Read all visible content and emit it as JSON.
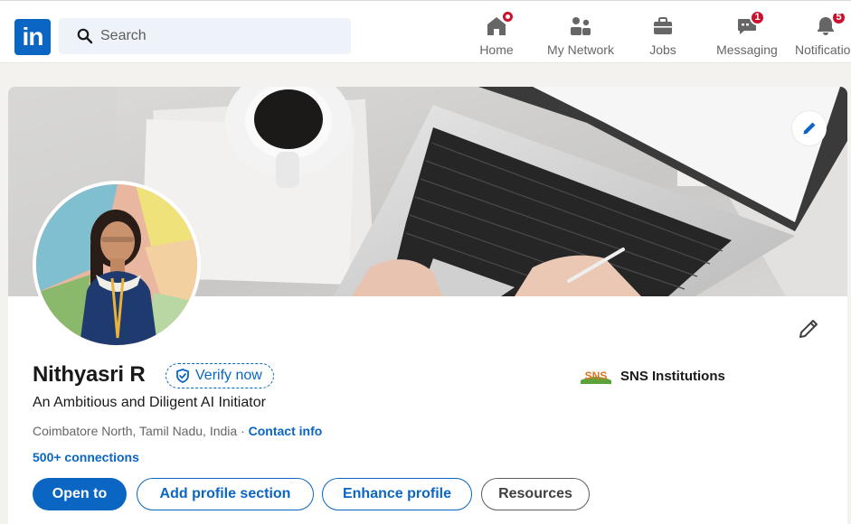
{
  "nav": {
    "search_placeholder": "Search",
    "items": [
      {
        "label": "Home",
        "icon": "home-icon",
        "badge": ""
      },
      {
        "label": "My Network",
        "icon": "network-icon",
        "badge": ""
      },
      {
        "label": "Jobs",
        "icon": "jobs-icon",
        "badge": ""
      },
      {
        "label": "Messaging",
        "icon": "messaging-icon",
        "badge": "1"
      },
      {
        "label": "Notifications",
        "icon": "bell-icon",
        "badge": "5"
      }
    ]
  },
  "profile": {
    "name": "Nithyasri R",
    "verify_label": "Verify now",
    "headline": "An Ambitious and Diligent AI Initiator",
    "location": "Coimbatore North, Tamil Nadu, India",
    "separator": " · ",
    "contact_info": "Contact info",
    "connections": "500+ connections",
    "organization": "SNS Institutions",
    "org_logo_text": "SNS"
  },
  "actions": {
    "open_to": "Open to",
    "add_section": "Add profile section",
    "enhance": "Enhance profile",
    "resources": "Resources"
  },
  "colors": {
    "brand": "#0a66c2",
    "badge": "#cb112d",
    "page_bg": "#f4f2ee"
  }
}
